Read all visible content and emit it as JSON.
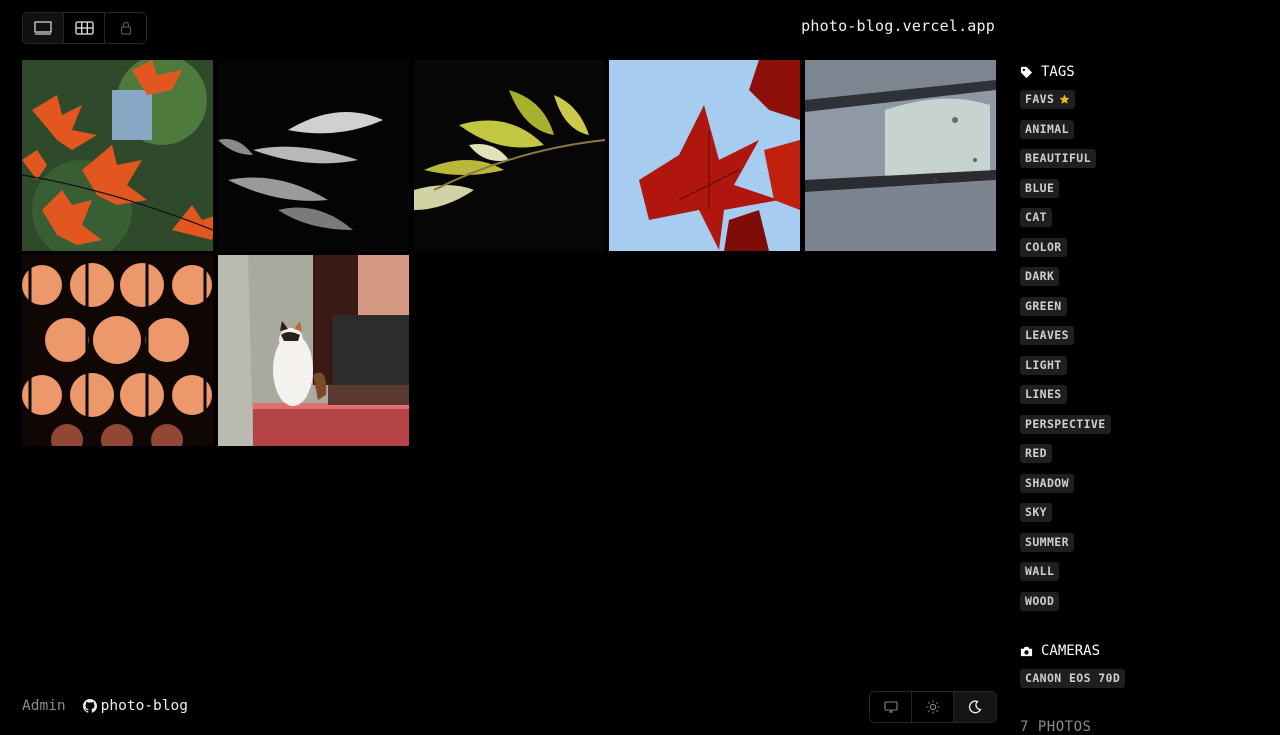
{
  "header": {
    "site_title": "photo-blog.vercel.app",
    "view_buttons": [
      {
        "icon": "full-frame-icon",
        "active": true
      },
      {
        "icon": "grid-icon",
        "active": false
      },
      {
        "icon": "lock-icon",
        "active": false
      }
    ]
  },
  "photos": [
    {
      "subject": "red maple leaves",
      "colors": [
        "#2f5a2c",
        "#e0521e"
      ]
    },
    {
      "subject": "backlit leaves in shadow",
      "colors": [
        "#050505",
        "#bdbdbd"
      ]
    },
    {
      "subject": "green leaves on dark",
      "colors": [
        "#060806",
        "#c0c23b"
      ]
    },
    {
      "subject": "red leaves against blue sky",
      "colors": [
        "#9fc8ee",
        "#a4130c"
      ]
    },
    {
      "subject": "painted brick wall",
      "colors": [
        "#6b7280",
        "#c8d4d2"
      ]
    },
    {
      "subject": "orange light pattern",
      "colors": [
        "#0b0604",
        "#ef9a6e"
      ]
    },
    {
      "subject": "calico cat on red step",
      "colors": [
        "#a7a79b",
        "#c94f4f"
      ]
    }
  ],
  "sidebar": {
    "tags_heading": "TAGS",
    "tags": [
      "FAVS",
      "ANIMAL",
      "BEAUTIFUL",
      "BLUE",
      "CAT",
      "COLOR",
      "DARK",
      "GREEN",
      "LEAVES",
      "LIGHT",
      "LINES",
      "PERSPECTIVE",
      "RED",
      "SHADOW",
      "SKY",
      "SUMMER",
      "WALL",
      "WOOD"
    ],
    "cameras_heading": "CAMERAS",
    "cameras": [
      "CANON EOS 70D"
    ],
    "photo_count": "7 PHOTOS"
  },
  "footer": {
    "admin_label": "Admin",
    "github_label": "photo-blog",
    "theme_buttons": [
      {
        "icon": "monitor-icon",
        "active": false
      },
      {
        "icon": "sun-icon",
        "active": false
      },
      {
        "icon": "moon-icon",
        "active": true
      }
    ]
  },
  "colors": {
    "background": "#000000",
    "tag_background": "#1f1f1f",
    "star": "#f5b81a"
  }
}
